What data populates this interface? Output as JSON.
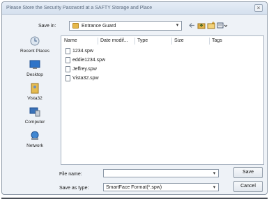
{
  "window": {
    "title": "Please Store the Security Password at a SAFTY Storage and Place",
    "close_glyph": "×"
  },
  "save_in": {
    "label": "Save in:",
    "value": "Entrance Guard"
  },
  "toolbar": {
    "icons": [
      "back-arrow-icon",
      "up-folder-icon",
      "new-folder-icon",
      "views-menu-icon"
    ]
  },
  "places": [
    {
      "label": "Recent Places",
      "icon": "recent-places-icon"
    },
    {
      "label": "Desktop",
      "icon": "desktop-icon"
    },
    {
      "label": "Vista32",
      "icon": "user-folder-icon"
    },
    {
      "label": "Computer",
      "icon": "computer-icon"
    },
    {
      "label": "Network",
      "icon": "network-icon"
    }
  ],
  "columns": [
    "Name",
    "Date modif...",
    "Type",
    "Size",
    "Tags"
  ],
  "files": [
    {
      "name": "1234.spw"
    },
    {
      "name": "eddie1234.spw"
    },
    {
      "name": "Jeffrey.spw"
    },
    {
      "name": "Vista32.spw"
    }
  ],
  "file_name": {
    "label": "File name:",
    "value": ""
  },
  "save_as_type": {
    "label": "Save as type:",
    "value": "SmartFace Format(*.spw)"
  },
  "buttons": {
    "save": "Save",
    "cancel": "Cancel"
  }
}
